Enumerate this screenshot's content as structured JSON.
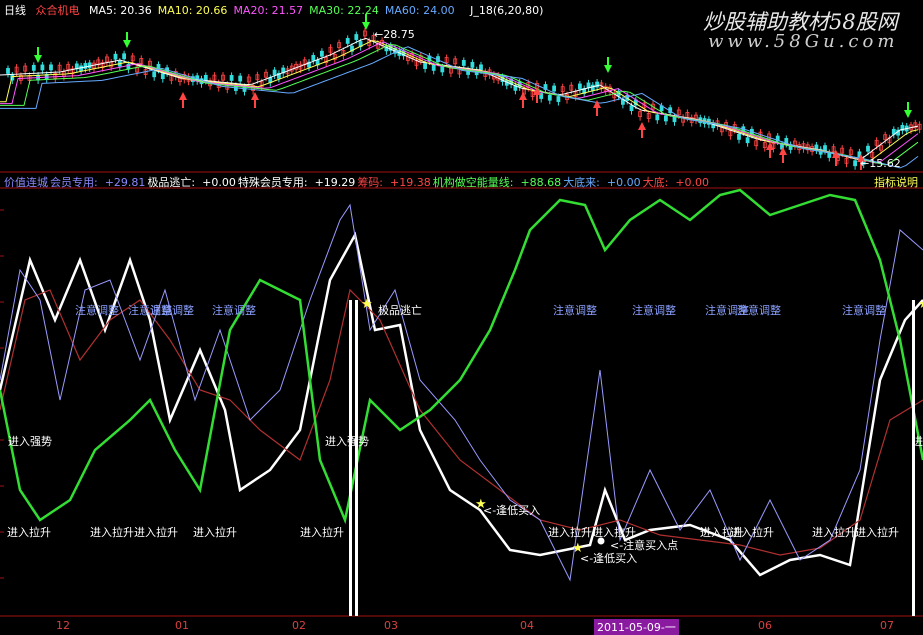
{
  "top_panel": {
    "period": "日线",
    "stock_name": "众合机电",
    "ma": [
      {
        "label": "MA5:",
        "value": "20.36",
        "color": "#ffffff"
      },
      {
        "label": "MA10:",
        "value": "20.66",
        "color": "#ffff55"
      },
      {
        "label": "MA20:",
        "value": "21.57",
        "color": "#ff55ff"
      },
      {
        "label": "MA30:",
        "value": "22.24",
        "color": "#55ff55"
      },
      {
        "label": "MA60:",
        "value": "24.00",
        "color": "#66aaff"
      }
    ],
    "indicator": "J_18(6,20,80)",
    "high_price": "28.75",
    "low_price": "15.62"
  },
  "bottom_panel": {
    "header": [
      {
        "text": "价值连城",
        "color": "#8888ff"
      },
      {
        "text": "会员专用:",
        "color": "#8888ff"
      },
      {
        "text": "+29.81",
        "color": "#8888ff"
      },
      {
        "text": "极品逃亡:",
        "color": "#ffffff"
      },
      {
        "text": "+0.00",
        "color": "#ffffff"
      },
      {
        "text": "特殊会员专用:",
        "color": "#ffffff"
      },
      {
        "text": "+19.29",
        "color": "#ffffff"
      },
      {
        "text": "筹码:",
        "color": "#ff4444"
      },
      {
        "text": "+19.38",
        "color": "#ff4444"
      },
      {
        "text": "机构做空能量线:",
        "color": "#55ff55"
      },
      {
        "text": "+88.68",
        "color": "#55ff55"
      },
      {
        "text": "大底来:",
        "color": "#66aaff"
      },
      {
        "text": "+0.00",
        "color": "#66aaff"
      },
      {
        "text": "大底:",
        "color": "#ff4444"
      },
      {
        "text": "+0.00",
        "color": "#ff4444"
      }
    ],
    "help_label": "指标说明"
  },
  "watermark": {
    "title": "炒股辅助教材58股网",
    "url": "www.58Gu.com"
  },
  "annotations": {
    "enter_strong": "进入强势",
    "enter_pull": "进入拉升",
    "attention_adjust": "注意调整",
    "buy_low": "<-逢低买入",
    "buy_point": "<-注意买入点",
    "top": "极品逃亡"
  },
  "x_axis": [
    "12",
    "01",
    "02",
    "03",
    "04",
    "05",
    "06",
    "07"
  ],
  "cursor_date": "2011-05-09-一"
}
